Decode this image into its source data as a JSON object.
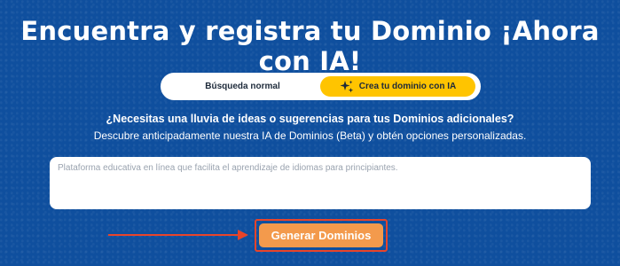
{
  "headline": "Encuentra y registra tu Dominio ¡Ahora con IA!",
  "tabs": {
    "normal_label": "Búsqueda normal",
    "ai_label": "Crea tu dominio con IA",
    "selected": "ai",
    "ai_icon": "sparkles-icon"
  },
  "intro": {
    "question": "¿Necesitas una lluvia de ideas o sugerencias para tus Dominios adicionales?",
    "subtitle": "Descubre anticipadamente nuestra IA de Dominios (Beta) y obtén opciones personalizadas."
  },
  "prompt": {
    "placeholder": "Plataforma educativa en línea que facilita el aprendizaje de idiomas para principiantes."
  },
  "cta": {
    "label": "Generar Dominios",
    "annotation_icon": "arrow-right-icon"
  },
  "colors": {
    "background": "#0f4f9e",
    "accent_yellow": "#ffc400",
    "button_orange": "#f39a4c",
    "annotation_red": "#e8442a"
  }
}
